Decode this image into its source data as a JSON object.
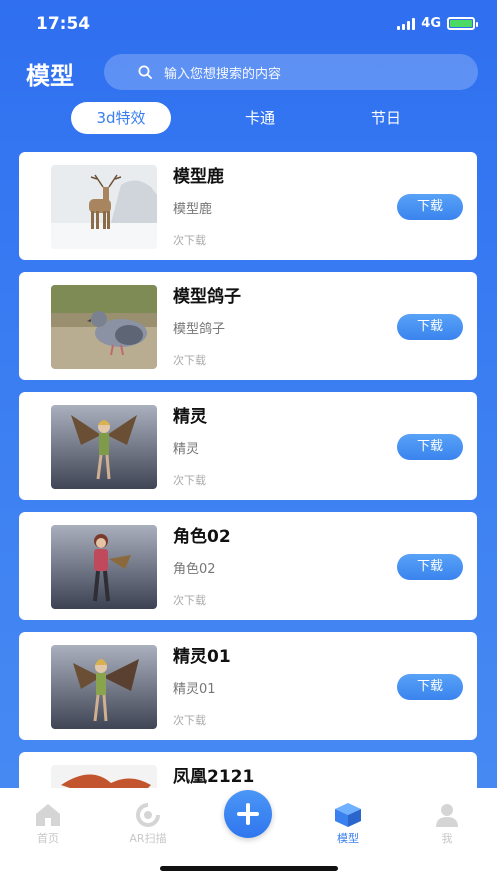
{
  "status": {
    "time": "17:54",
    "network": "4G"
  },
  "header": {
    "title": "模型",
    "search_placeholder": "输入您想搜索的内容"
  },
  "tabs": [
    {
      "label": "3d特效",
      "active": true
    },
    {
      "label": "卡通",
      "active": false
    },
    {
      "label": "节日",
      "active": false
    }
  ],
  "items": [
    {
      "title": "模型鹿",
      "subtitle": "模型鹿",
      "count": "次下载",
      "button": "下载",
      "thumb_icon": "deer-image"
    },
    {
      "title": "模型鸽子",
      "subtitle": "模型鸽子",
      "count": "次下载",
      "button": "下载",
      "thumb_icon": "pigeon-image"
    },
    {
      "title": "精灵",
      "subtitle": "精灵",
      "count": "次下载",
      "button": "下载",
      "thumb_icon": "fairy-image"
    },
    {
      "title": "角色02",
      "subtitle": "角色02",
      "count": "次下载",
      "button": "下载",
      "thumb_icon": "character-image"
    },
    {
      "title": "精灵01",
      "subtitle": "精灵01",
      "count": "次下载",
      "button": "下载",
      "thumb_icon": "fairy-image"
    },
    {
      "title": "凤凰2121",
      "subtitle": "",
      "count": "",
      "button": "",
      "thumb_icon": "phoenix-image"
    }
  ],
  "tabbar": {
    "home": "首页",
    "ar": "AR扫描",
    "model": "模型",
    "me": "我"
  },
  "colors": {
    "accent": "#3a80ee",
    "background_top": "#2f6ff0",
    "button": "#4a93f3"
  }
}
